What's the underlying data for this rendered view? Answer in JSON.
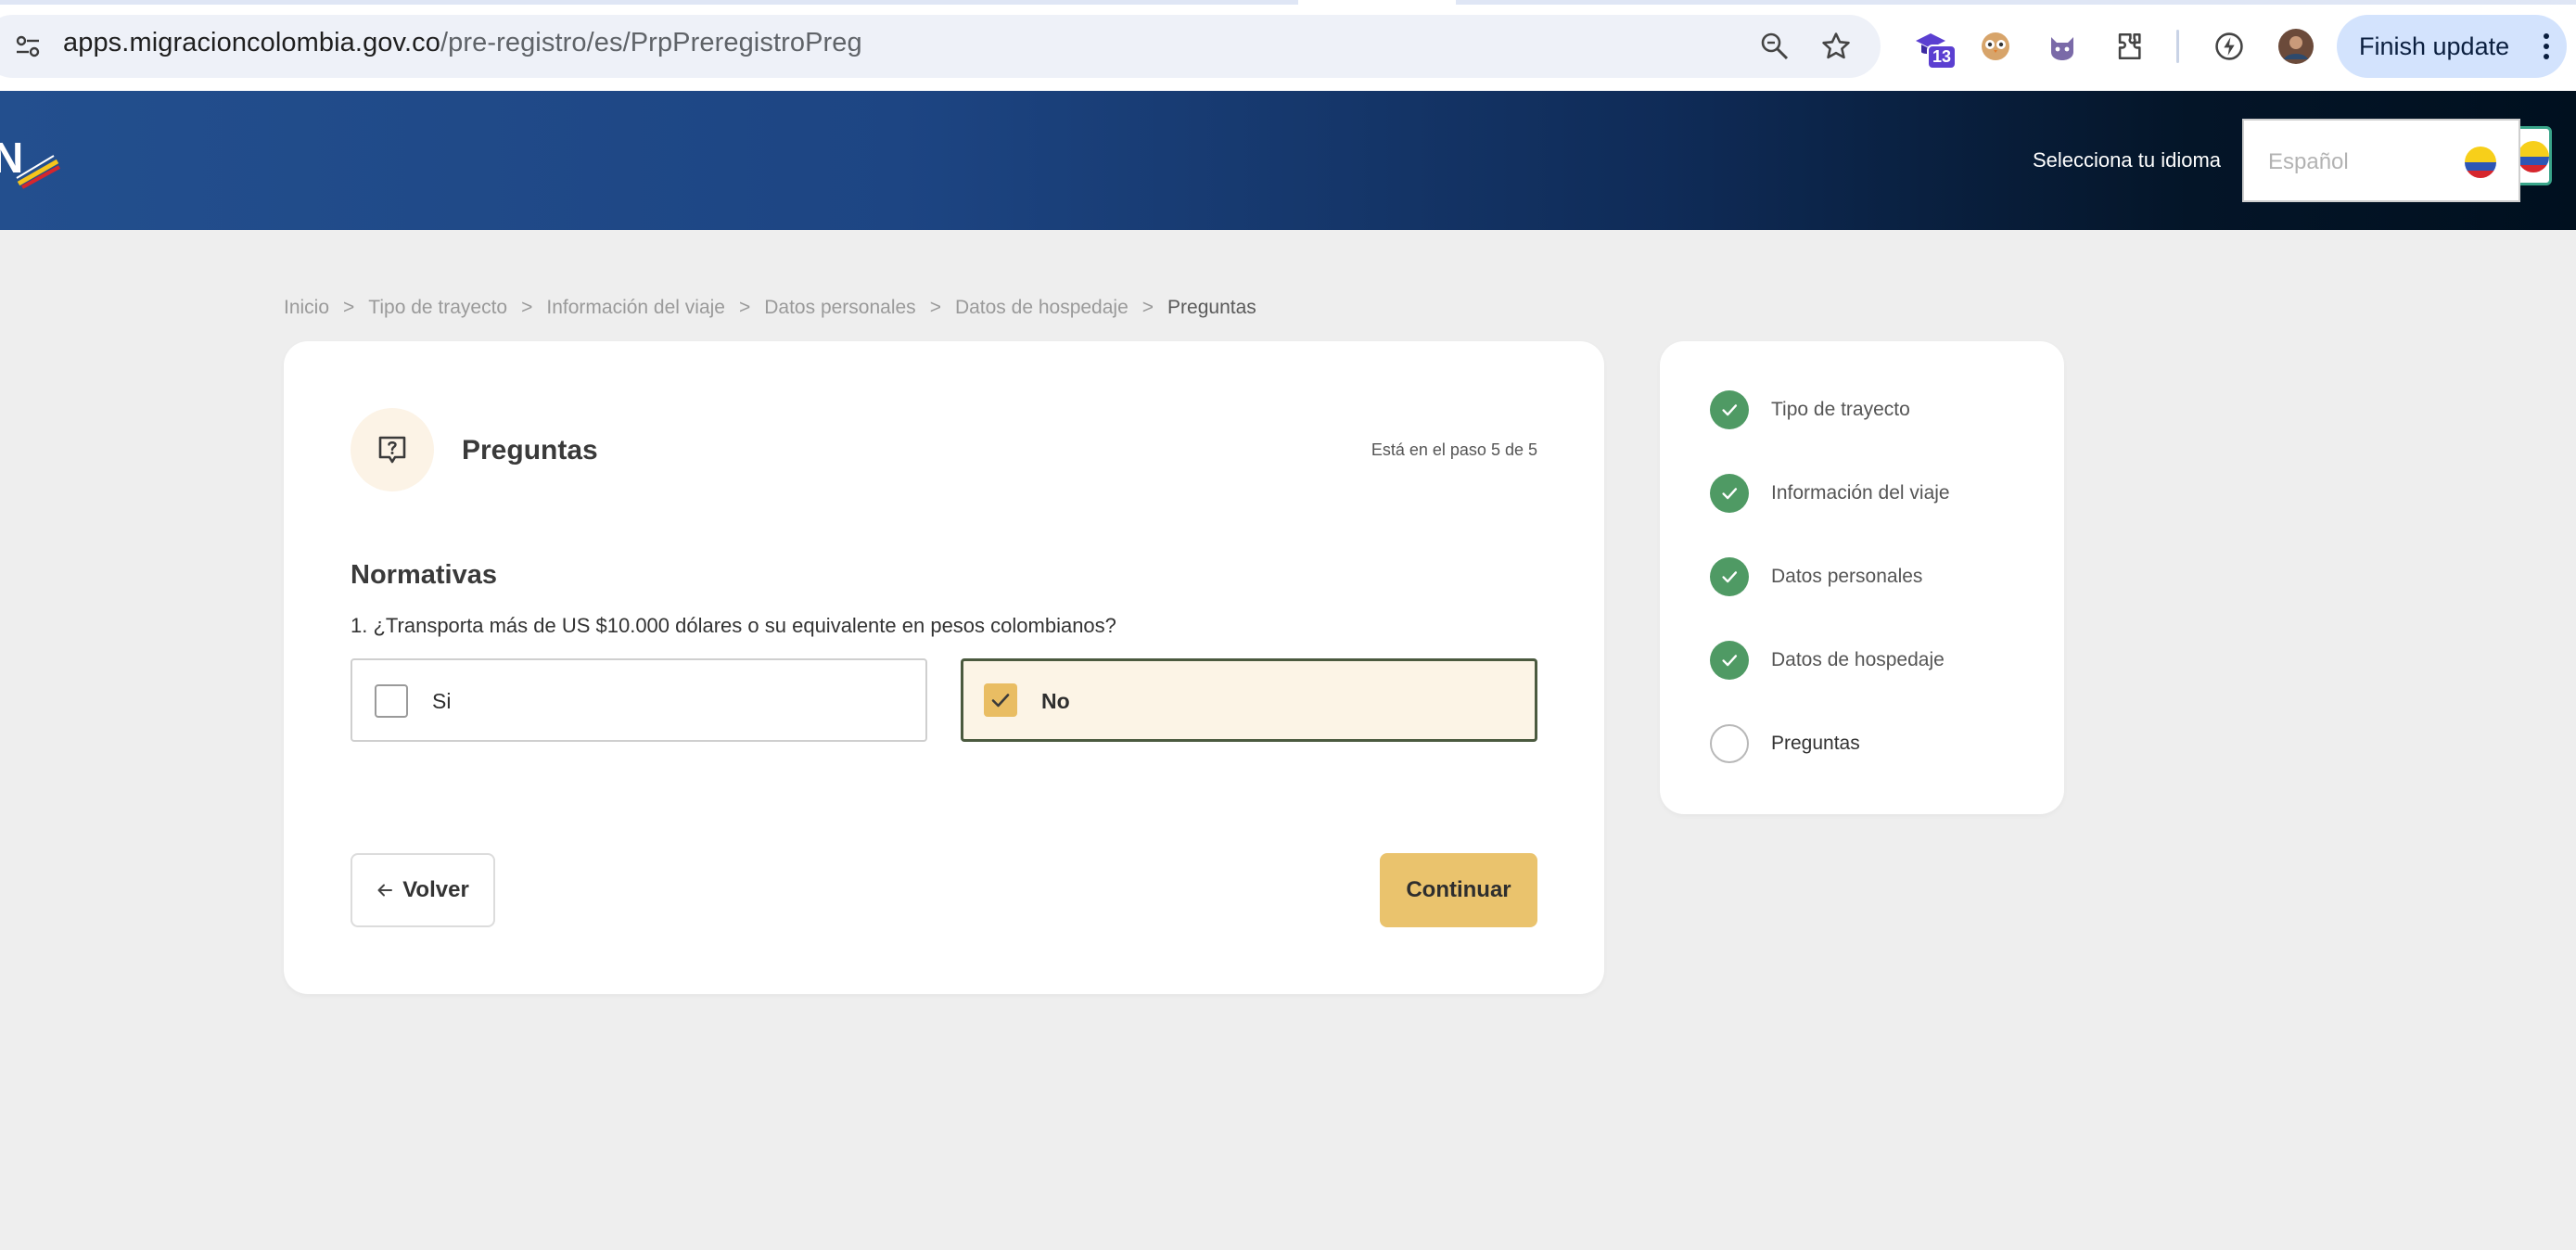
{
  "browser": {
    "url_host": "apps.migracioncolombia.gov.co",
    "url_path": "/pre-registro/es/PrpPreregistroPreg",
    "extension_badge": "13",
    "finish_update_label": "Finish update"
  },
  "header": {
    "logo_text": "N",
    "language_label": "Selecciona tu idioma",
    "language_placeholder": "Español"
  },
  "breadcrumb": {
    "items": [
      "Inicio",
      "Tipo de trayecto",
      "Información del viaje",
      "Datos personales",
      "Datos de hospedaje",
      "Preguntas"
    ],
    "separator": ">"
  },
  "form": {
    "title": "Preguntas",
    "step_info": "Está en el paso 5 de 5",
    "section_title": "Normativas",
    "question": "1. ¿Transporta más de US $10.000 dólares o su equivalente en pesos colombianos?",
    "options": [
      {
        "label": "Si",
        "selected": false
      },
      {
        "label": "No",
        "selected": true
      }
    ],
    "back_label": "Volver",
    "continue_label": "Continuar"
  },
  "progress": {
    "steps": [
      {
        "label": "Tipo de trayecto",
        "done": true
      },
      {
        "label": "Información del viaje",
        "done": true
      },
      {
        "label": "Datos personales",
        "done": true
      },
      {
        "label": "Datos de hospedaje",
        "done": true
      },
      {
        "label": "Preguntas",
        "done": false
      }
    ]
  },
  "colors": {
    "accent_yellow": "#eac36d",
    "check_green": "#4f9a64",
    "header_blue": "#1d4583"
  }
}
